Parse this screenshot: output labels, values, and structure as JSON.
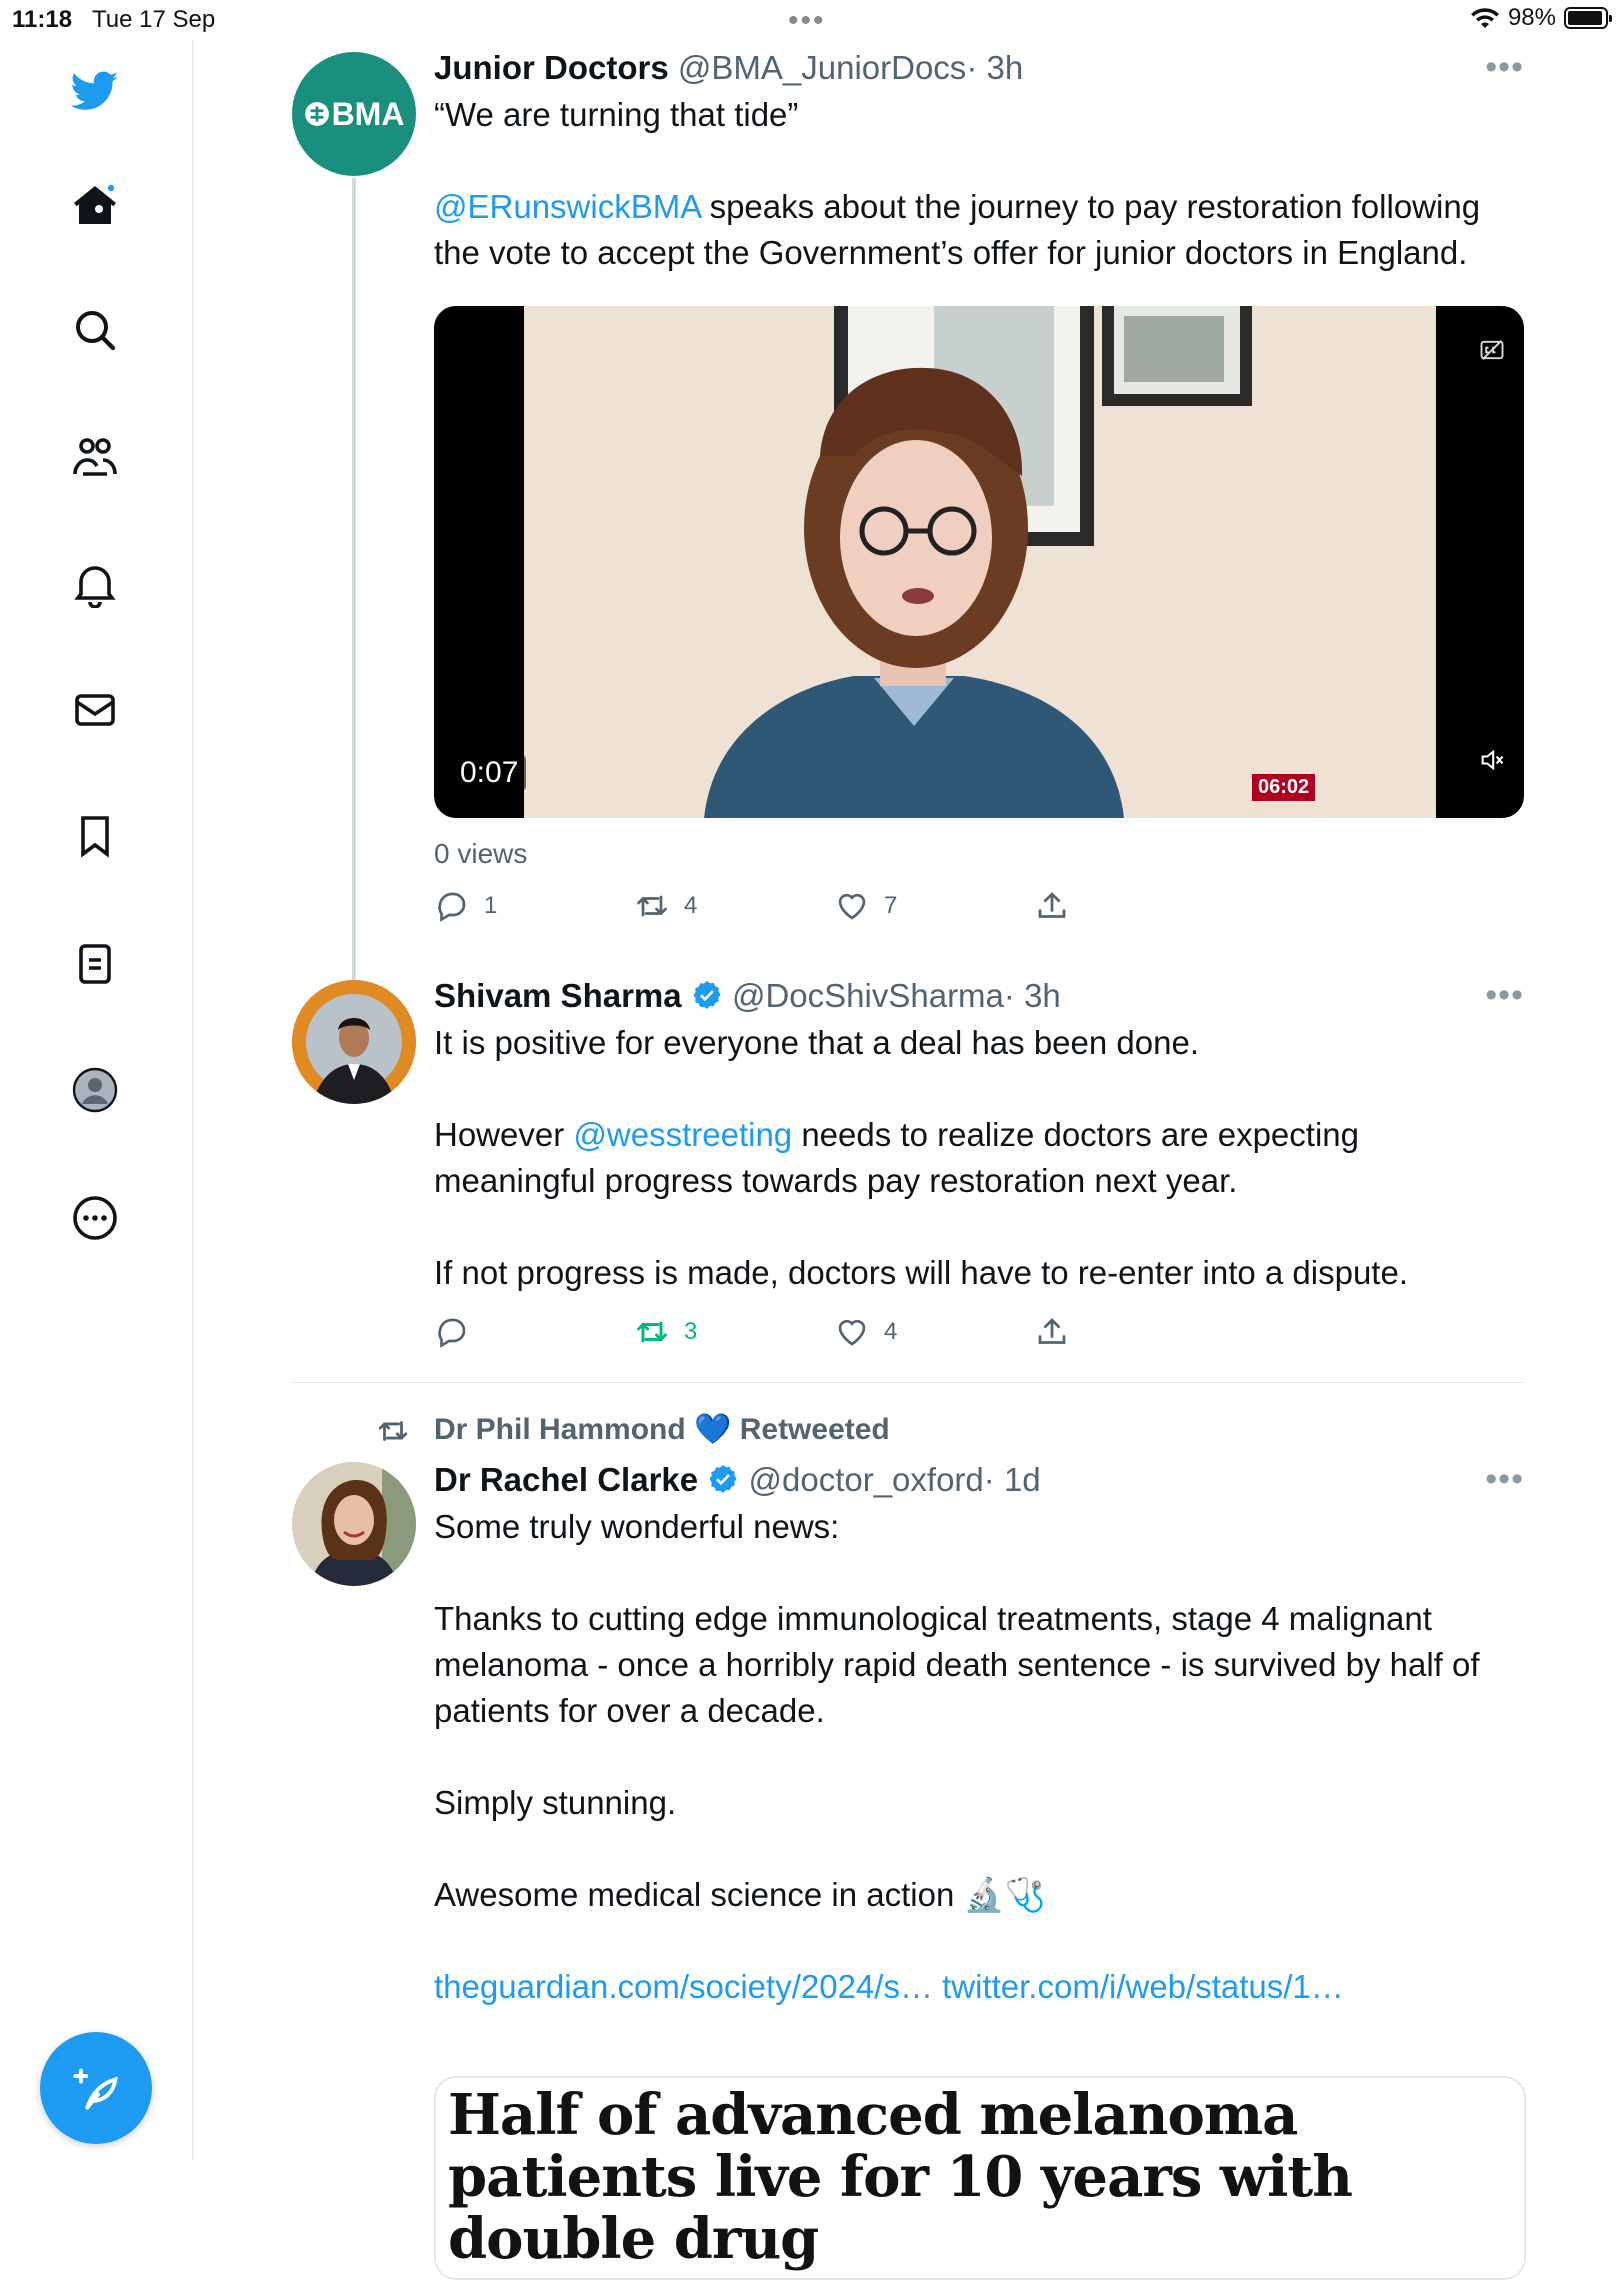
{
  "status_bar": {
    "time": "11:18",
    "date": "Tue 17 Sep",
    "battery": "98%"
  },
  "sidebar": {
    "items": [
      "twitter-logo",
      "home",
      "search",
      "communities",
      "notifications",
      "messages",
      "bookmarks",
      "lists",
      "profile",
      "more"
    ],
    "accent": "#1d9bf0"
  },
  "tweets": [
    {
      "name": "Junior Doctors",
      "handle": "@BMA_JuniorDocs",
      "time": "· 3h",
      "avatar_text": "BMA",
      "text_line1": "“We are turning that tide”",
      "mention": "@ERunswickBMA",
      "text_rest": " speaks about the journey to pay restoration following the vote to accept the Government’s offer for junior doctors in England.",
      "video_time": "0:07",
      "video_badge": "06:02",
      "views": "0 views",
      "replies": "1",
      "retweets": "4",
      "likes": "7"
    },
    {
      "name": "Shivam Sharma",
      "handle": "@DocShivSharma",
      "time": "· 3h",
      "p1": "It is positive for everyone that a deal has been done.",
      "p2_pre": "However ",
      "p2_mention": "@wesstreeting",
      "p2_post": " needs to realize doctors are expecting meaningful progress towards pay restoration next year.",
      "p3": "If not progress is made, doctors will have to re-enter into a dispute.",
      "replies": "",
      "retweets": "3",
      "likes": "4",
      "retweet_color": "#00ba7c"
    },
    {
      "retweeted_by": "Dr Phil Hammond 💙 Retweeted",
      "name": "Dr Rachel Clarke",
      "handle": "@doctor_oxford",
      "time": "· 1d",
      "p1": "Some truly wonderful news:",
      "p2": "Thanks to cutting edge immunological treatments, stage 4 malignant melanoma - once a horribly rapid death sentence - is survived by half of patients for over a decade.",
      "p3": "Simply stunning.",
      "p4": "Awesome medical science in action 🔬🩺",
      "links": "theguardian.com/society/2024/s… twitter.com/i/web/status/1…",
      "card_title": "Half of advanced melanoma patients live for 10 years with double drug"
    }
  ]
}
